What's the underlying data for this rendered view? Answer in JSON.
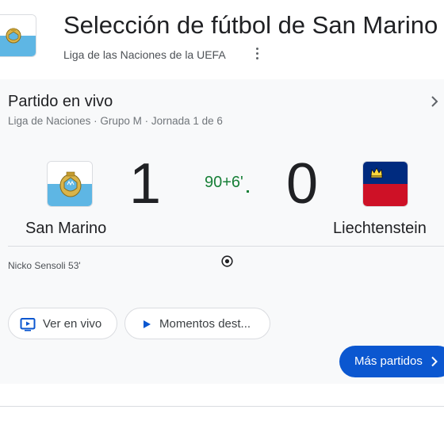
{
  "header": {
    "title": "Selección de fútbol de San Marino",
    "subtitle": "Liga de las Naciones de la UEFA"
  },
  "match": {
    "heading": "Partido en vivo",
    "details": "Liga de Naciones · Grupo M · Jornada 1 de 6",
    "minute": "90+6'",
    "home": {
      "name": "San Marino",
      "score": "1"
    },
    "away": {
      "name": "Liechtenstein",
      "score": "0"
    },
    "events": [
      {
        "text": "Nicko Sensoli 53'"
      }
    ]
  },
  "actions": {
    "watch_live": "Ver en vivo",
    "highlights": "Momentos dest...",
    "more_matches": "Más partidos"
  },
  "icons": {
    "header_flag": "san-marino-flag-icon",
    "heading_chevron": "chevron-right-icon",
    "goal": "soccer-ball-icon",
    "watch": "live-tv-icon",
    "play": "play-icon"
  },
  "colors": {
    "accent_blue": "#0b57d0",
    "live_green": "#188038",
    "san_marino_blue": "#5eb6e4",
    "liechtenstein_blue": "#002b7f",
    "liechtenstein_red": "#ce1126"
  }
}
